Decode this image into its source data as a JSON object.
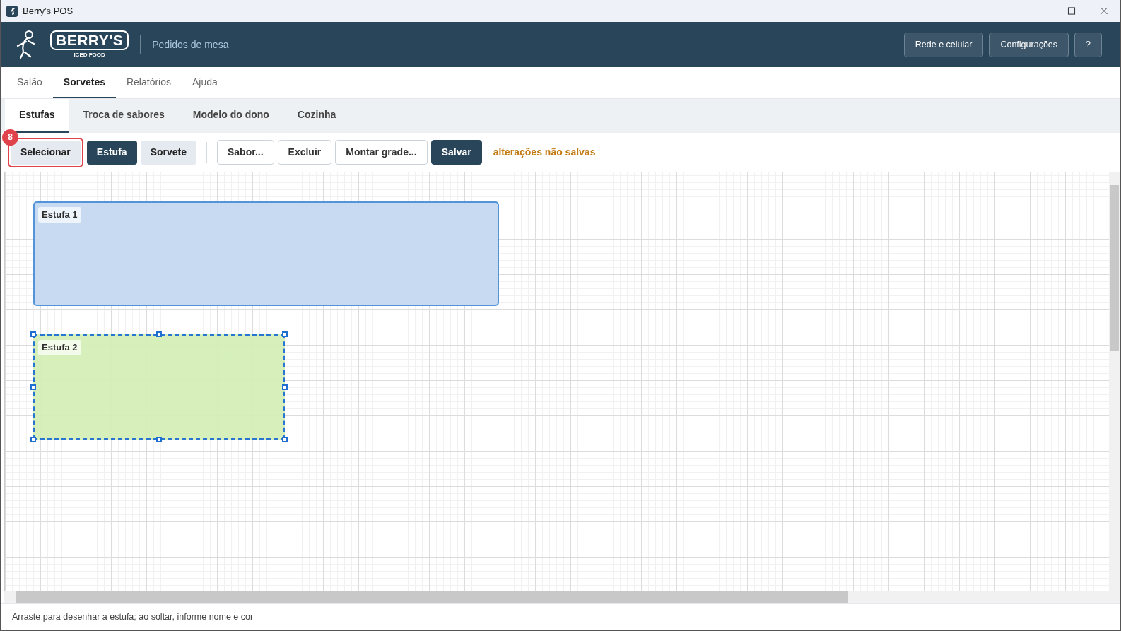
{
  "window": {
    "title": "Berry's POS"
  },
  "header": {
    "brand": "BERRY'S",
    "brand_sub": "ICED FOOD",
    "subtitle": "Pedidos de mesa",
    "buttons": [
      "Rede e celular",
      "Configurações",
      "?"
    ]
  },
  "main_tabs": [
    {
      "label": "Salão",
      "selected": false
    },
    {
      "label": "Sorvetes",
      "selected": true
    },
    {
      "label": "Relatórios",
      "selected": false
    },
    {
      "label": "Ajuda",
      "selected": false
    }
  ],
  "sub_tabs": [
    {
      "label": "Estufas",
      "selected": true
    },
    {
      "label": "Troca de sabores",
      "selected": false
    },
    {
      "label": "Modelo do dono",
      "selected": false
    },
    {
      "label": "Cozinha",
      "selected": false
    }
  ],
  "toolbar": {
    "modes": [
      {
        "label": "Selecionar",
        "selected": false,
        "annotation": "8"
      },
      {
        "label": "Estufa",
        "selected": true
      },
      {
        "label": "Sorvete",
        "selected": false
      }
    ],
    "actions": [
      {
        "label": "Sabor...",
        "kind": "outline"
      },
      {
        "label": "Excluir",
        "kind": "outline"
      },
      {
        "label": "Montar grade...",
        "kind": "outline"
      },
      {
        "label": "Salvar",
        "kind": "primary"
      }
    ],
    "status": "alterações não salvas"
  },
  "canvas": {
    "estufas": [
      {
        "name": "Estufa 1",
        "color": "#c5d9f1",
        "selected": false
      },
      {
        "name": "Estufa 2",
        "color": "#d5f0b8",
        "selected": true
      }
    ]
  },
  "status_bar": "Arraste para desenhar a estufa; ao soltar, informe nome e cor"
}
